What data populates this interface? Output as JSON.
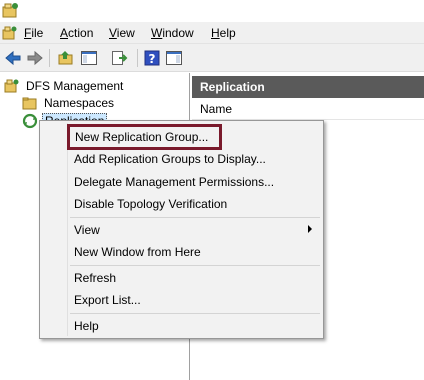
{
  "menubar": {
    "items": [
      {
        "label": "File",
        "accel": "F"
      },
      {
        "label": "Action",
        "accel": "A"
      },
      {
        "label": "View",
        "accel": "V"
      },
      {
        "label": "Window",
        "accel": "W"
      },
      {
        "label": "Help",
        "accel": "H"
      }
    ]
  },
  "toolbar": {
    "icons": [
      "back-arrow-icon",
      "forward-arrow-icon",
      "up-folder-icon",
      "show-hide-tree-icon",
      "export-list-icon",
      "help-icon",
      "show-hide-action-pane-icon"
    ]
  },
  "tree": {
    "root": "DFS Management",
    "children": [
      "Namespaces",
      "Replication"
    ]
  },
  "results": {
    "header": "Replication",
    "column_name": "Name"
  },
  "context_menu": {
    "groups": [
      [
        "New Replication Group...",
        "Add Replication Groups to Display...",
        "Delegate Management Permissions...",
        "Disable Topology Verification"
      ],
      [
        "View",
        "New Window from Here"
      ],
      [
        "Refresh",
        "Export List..."
      ],
      [
        "Help"
      ]
    ],
    "highlighted": "New Replication Group...",
    "submenu_item": "View"
  },
  "colors": {
    "results_header_bg": "#5a5a5a",
    "highlight_border": "#7a1a2c",
    "menu_bg": "#f2f2f2"
  }
}
